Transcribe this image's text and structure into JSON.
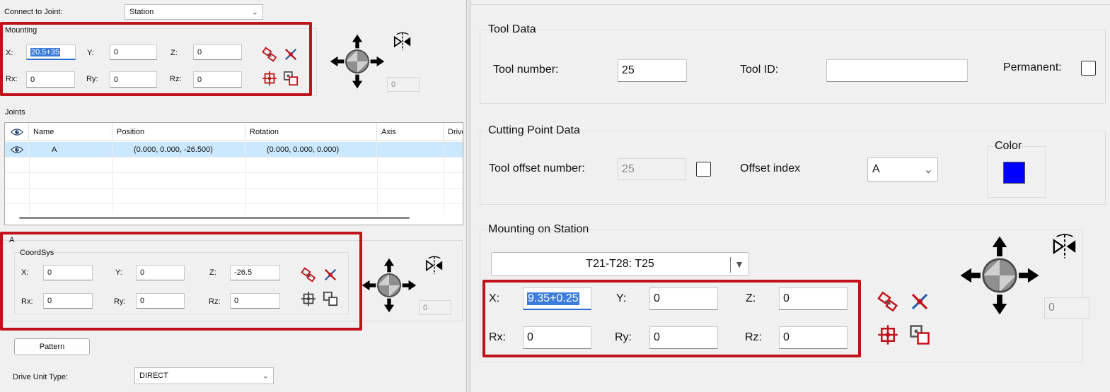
{
  "left": {
    "connect_label": "Connect to Joint:",
    "connect_value": "Station",
    "mounting": {
      "title": "Mounting",
      "x_label": "X:",
      "x_value": "20.5+35",
      "y_label": "Y:",
      "y_value": "0",
      "z_label": "Z:",
      "z_value": "0",
      "rx_label": "Rx:",
      "rx_value": "0",
      "ry_label": "Ry:",
      "ry_value": "0",
      "rz_label": "Rz:",
      "rz_value": "0",
      "step_value": "0"
    },
    "joints": {
      "title": "Joints",
      "columns": [
        "Name",
        "Position",
        "Rotation",
        "Axis",
        "Drive"
      ],
      "rows": [
        {
          "name": "A",
          "position": "(0.000, 0.000, -26.500)",
          "rotation": "(0.000, 0.000, 0.000)",
          "axis": ""
        }
      ]
    },
    "joint_a": {
      "title": "A",
      "coordsys_title": "CoordSys",
      "x_label": "X:",
      "x_value": "0",
      "y_label": "Y:",
      "y_value": "0",
      "z_label": "Z:",
      "z_value": "-26.5",
      "rx_label": "Rx:",
      "rx_value": "0",
      "ry_label": "Ry:",
      "ry_value": "0",
      "rz_label": "Rz:",
      "rz_value": "0",
      "step_value": "0"
    },
    "pattern_label": "Pattern",
    "drive_unit_label": "Drive Unit Type:",
    "drive_unit_value": "DIRECT"
  },
  "right": {
    "tool_data": {
      "title": "Tool Data",
      "tool_number_label": "Tool number:",
      "tool_number_value": "25",
      "tool_id_label": "Tool ID:",
      "tool_id_value": "",
      "permanent_label": "Permanent:"
    },
    "cutting": {
      "title": "Cutting Point Data",
      "offset_number_label": "Tool offset number:",
      "offset_number_value": "25",
      "offset_index_label": "Offset index",
      "offset_index_value": "A",
      "color_label": "Color",
      "color_hex": "#0000ff"
    },
    "mounting_station": {
      "title": "Mounting on Station",
      "station_value": "T21-T28: T25",
      "x_label": "X:",
      "x_value": "9.35+0.25",
      "y_label": "Y:",
      "y_value": "0",
      "z_label": "Z:",
      "z_value": "0",
      "rx_label": "Rx:",
      "rx_value": "0",
      "ry_label": "Ry:",
      "ry_value": "0",
      "rz_label": "Rz:",
      "rz_value": "0",
      "step_value": "0"
    }
  },
  "colors": {
    "highlight": "#c0121a",
    "selection_row": "#cce8ff",
    "text_selection": "#3b7ddb"
  }
}
